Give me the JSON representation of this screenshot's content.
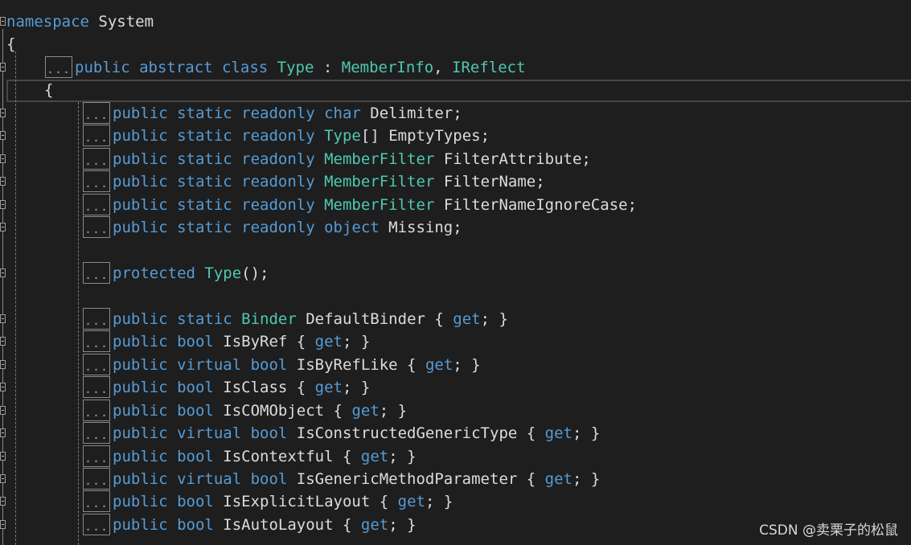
{
  "lines": [
    {
      "fold": true,
      "ellipsis": false,
      "code_indent": 8,
      "tokens": [
        [
          "kw",
          "namespace"
        ],
        [
          "tx",
          " System"
        ]
      ]
    },
    {
      "fold": false,
      "ellipsis": false,
      "code_indent": 8,
      "tokens": [
        [
          "tx",
          "{"
        ]
      ]
    },
    {
      "fold": true,
      "ellipsis": true,
      "code_indent": 93,
      "tokens": [
        [
          "kw",
          "public abstract class "
        ],
        [
          "ty",
          "Type"
        ],
        [
          "tx",
          " : "
        ],
        [
          "ty",
          "MemberInfo"
        ],
        [
          "tx",
          ", "
        ],
        [
          "ty",
          "IReflect"
        ]
      ]
    },
    {
      "fold": false,
      "ellipsis": false,
      "code_indent": 55,
      "tokens": [
        [
          "tx",
          "{"
        ]
      ]
    },
    {
      "fold": true,
      "ellipsis": true,
      "code_indent": 140,
      "tokens": [
        [
          "kw",
          "public static readonly char "
        ],
        [
          "tx",
          "Delimiter;"
        ]
      ]
    },
    {
      "fold": true,
      "ellipsis": true,
      "code_indent": 140,
      "tokens": [
        [
          "kw",
          "public static readonly "
        ],
        [
          "ty",
          "Type"
        ],
        [
          "tx",
          "[] EmptyTypes;"
        ]
      ]
    },
    {
      "fold": true,
      "ellipsis": true,
      "code_indent": 140,
      "tokens": [
        [
          "kw",
          "public static readonly "
        ],
        [
          "ty",
          "MemberFilter"
        ],
        [
          "tx",
          " FilterAttribute;"
        ]
      ]
    },
    {
      "fold": true,
      "ellipsis": true,
      "code_indent": 140,
      "tokens": [
        [
          "kw",
          "public static readonly "
        ],
        [
          "ty",
          "MemberFilter"
        ],
        [
          "tx",
          " FilterName;"
        ]
      ]
    },
    {
      "fold": true,
      "ellipsis": true,
      "code_indent": 140,
      "tokens": [
        [
          "kw",
          "public static readonly "
        ],
        [
          "ty",
          "MemberFilter"
        ],
        [
          "tx",
          " FilterNameIgnoreCase;"
        ]
      ]
    },
    {
      "fold": true,
      "ellipsis": true,
      "code_indent": 140,
      "tokens": [
        [
          "kw",
          "public static readonly object "
        ],
        [
          "tx",
          "Missing;"
        ]
      ]
    },
    {
      "fold": false,
      "ellipsis": false,
      "code_indent": 140,
      "tokens": []
    },
    {
      "fold": true,
      "ellipsis": true,
      "code_indent": 140,
      "tokens": [
        [
          "kw",
          "protected "
        ],
        [
          "ty",
          "Type"
        ],
        [
          "tx",
          "();"
        ]
      ]
    },
    {
      "fold": false,
      "ellipsis": false,
      "code_indent": 140,
      "tokens": []
    },
    {
      "fold": true,
      "ellipsis": true,
      "code_indent": 140,
      "tokens": [
        [
          "kw",
          "public static "
        ],
        [
          "ty",
          "Binder"
        ],
        [
          "tx",
          " DefaultBinder { "
        ],
        [
          "kw",
          "get"
        ],
        [
          "tx",
          "; }"
        ]
      ]
    },
    {
      "fold": true,
      "ellipsis": true,
      "code_indent": 140,
      "tokens": [
        [
          "kw",
          "public bool "
        ],
        [
          "tx",
          "IsByRef { "
        ],
        [
          "kw",
          "get"
        ],
        [
          "tx",
          "; }"
        ]
      ]
    },
    {
      "fold": true,
      "ellipsis": true,
      "code_indent": 140,
      "tokens": [
        [
          "kw",
          "public virtual bool "
        ],
        [
          "tx",
          "IsByRefLike { "
        ],
        [
          "kw",
          "get"
        ],
        [
          "tx",
          "; }"
        ]
      ]
    },
    {
      "fold": true,
      "ellipsis": true,
      "code_indent": 140,
      "tokens": [
        [
          "kw",
          "public bool "
        ],
        [
          "tx",
          "IsClass { "
        ],
        [
          "kw",
          "get"
        ],
        [
          "tx",
          "; }"
        ]
      ]
    },
    {
      "fold": true,
      "ellipsis": true,
      "code_indent": 140,
      "tokens": [
        [
          "kw",
          "public bool "
        ],
        [
          "tx",
          "IsCOMObject { "
        ],
        [
          "kw",
          "get"
        ],
        [
          "tx",
          "; }"
        ]
      ]
    },
    {
      "fold": true,
      "ellipsis": true,
      "code_indent": 140,
      "tokens": [
        [
          "kw",
          "public virtual bool "
        ],
        [
          "tx",
          "IsConstructedGenericType { "
        ],
        [
          "kw",
          "get"
        ],
        [
          "tx",
          "; }"
        ]
      ]
    },
    {
      "fold": true,
      "ellipsis": true,
      "code_indent": 140,
      "tokens": [
        [
          "kw",
          "public bool "
        ],
        [
          "tx",
          "IsContextful { "
        ],
        [
          "kw",
          "get"
        ],
        [
          "tx",
          "; }"
        ]
      ]
    },
    {
      "fold": true,
      "ellipsis": true,
      "code_indent": 140,
      "tokens": [
        [
          "kw",
          "public virtual bool "
        ],
        [
          "tx",
          "IsGenericMethodParameter { "
        ],
        [
          "kw",
          "get"
        ],
        [
          "tx",
          "; }"
        ]
      ]
    },
    {
      "fold": true,
      "ellipsis": true,
      "code_indent": 140,
      "tokens": [
        [
          "kw",
          "public bool "
        ],
        [
          "tx",
          "IsExplicitLayout { "
        ],
        [
          "kw",
          "get"
        ],
        [
          "tx",
          "; }"
        ]
      ]
    },
    {
      "fold": true,
      "ellipsis": true,
      "code_indent": 140,
      "tokens": [
        [
          "kw",
          "public bool "
        ],
        [
          "tx",
          "IsAutoLayout { "
        ],
        [
          "kw",
          "get"
        ],
        [
          "tx",
          "; }"
        ]
      ]
    }
  ],
  "ellipsis_text": "...",
  "watermark": "CSDN @卖栗子的松鼠",
  "colors": {
    "background": "#1e1e1e",
    "keyword": "#569cd6",
    "type": "#4ec9b0",
    "text": "#dcdcdc"
  }
}
